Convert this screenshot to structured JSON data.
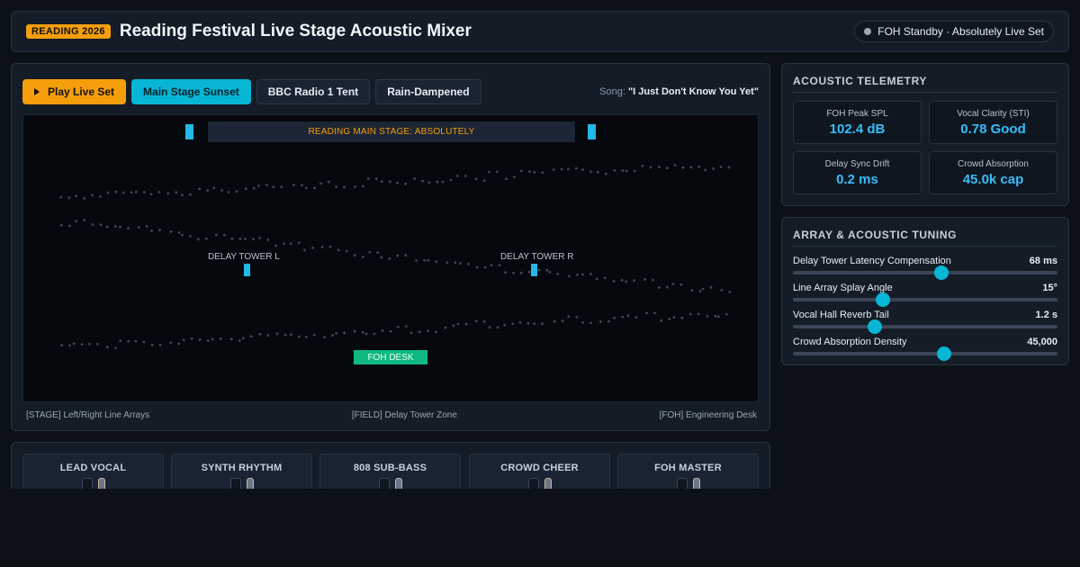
{
  "header": {
    "badge": "READING 2026",
    "title": "Reading Festival Live Stage Acoustic Mixer",
    "status": "FOH Standby · Absolutely Live Set"
  },
  "toolbar": {
    "play_label": "Play Live Set",
    "presets": [
      "Main Stage Sunset",
      "BBC Radio 1 Tent",
      "Rain-Dampened"
    ],
    "active_preset": "Main Stage Sunset",
    "song_prefix": "Song:",
    "song_title": "\"I Just Don't Know You Yet\""
  },
  "stage": {
    "banner": "READING MAIN STAGE: ABSOLUTELY",
    "tower_left": "DELAY TOWER L",
    "tower_right": "DELAY TOWER R",
    "foh": "FOH DESK",
    "zones": [
      "[STAGE] Left/Right Line Arrays",
      "[FIELD] Delay Tower Zone",
      "[FOH] Engineering Desk"
    ]
  },
  "telemetry": {
    "title": "ACOUSTIC TELEMETRY",
    "tiles": [
      {
        "label": "FOH Peak SPL",
        "value": "102.4 dB"
      },
      {
        "label": "Vocal Clarity (STI)",
        "value": "0.78 Good"
      },
      {
        "label": "Delay Sync Drift",
        "value": "0.2 ms"
      },
      {
        "label": "Crowd Absorption",
        "value": "45.0k cap"
      }
    ]
  },
  "tuning": {
    "title": "ARRAY & ACOUSTIC TUNING",
    "sliders": [
      {
        "label": "Delay Tower Latency Compensation",
        "value": "68 ms",
        "level": 0.56
      },
      {
        "label": "Line Array Splay Angle",
        "value": "15°",
        "level": 0.34
      },
      {
        "label": "Vocal Hall Reverb Tail",
        "value": "1.2 s",
        "level": 0.31
      },
      {
        "label": "Crowd Absorption Density",
        "value": "45,000",
        "level": 0.57
      }
    ]
  },
  "mixer": {
    "channels": [
      "LEAD VOCAL",
      "SYNTH RHYTHM",
      "808 SUB-BASS",
      "CROWD CHEER",
      "FOH MASTER"
    ]
  },
  "colors": {
    "accent": "#f59e0b",
    "cyan": "#06b6d4",
    "foh": "#10b981",
    "background": "#0c1118"
  }
}
